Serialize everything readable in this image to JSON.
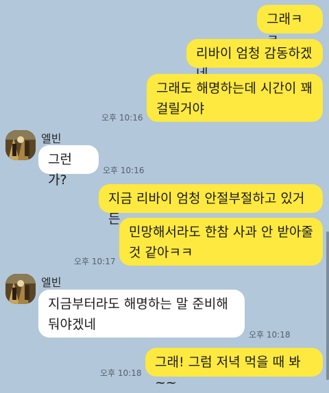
{
  "messages": [
    {
      "side": "me",
      "lines": [
        "그래ㅋㅋ"
      ]
    },
    {
      "side": "me",
      "lines": [
        "리바이 엄청 감동하겠네"
      ]
    },
    {
      "side": "me",
      "lines": [
        "그래도 해명하는데 시간이 꽤",
        "걸릴거야"
      ],
      "time": "오후 10:16"
    },
    {
      "side": "them",
      "sender": "엘빈",
      "lines": [
        "그런가?"
      ],
      "time": "오후 10:16"
    },
    {
      "side": "me",
      "lines": [
        "지금 리바이 엄청 안절부절하고 있거든"
      ]
    },
    {
      "side": "me",
      "lines": [
        "민망해서라도 한참 사과 안 받아줄",
        "것 같아ㅋㅋ"
      ],
      "time": "오후 10:17"
    },
    {
      "side": "them",
      "sender": "엘빈",
      "lines": [
        "지금부터라도 해명하는 말 준비해",
        "둬야겠네"
      ],
      "time": "오후 10:18"
    },
    {
      "side": "me",
      "lines": [
        "그래! 그럼 저녁 먹을 때 봐~~"
      ],
      "time": "오후 10:18"
    }
  ]
}
